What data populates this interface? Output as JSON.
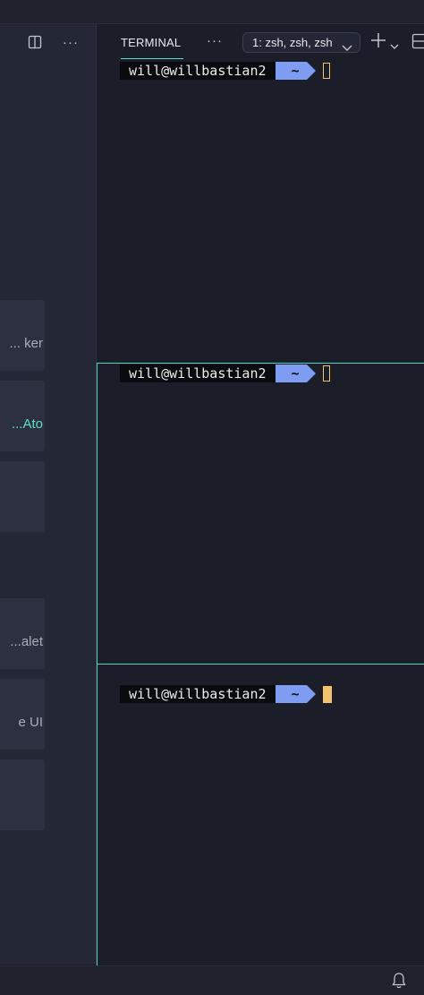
{
  "terminal_panel": {
    "tab_label": "TERMINAL",
    "more_label": "···",
    "terminal_select_value": "1: zsh, zsh, zsh",
    "icons": [
      "more-icon",
      "chevron-down-icon",
      "plus-icon",
      "split-terminal-icon"
    ]
  },
  "editor_pane": {
    "icons": [
      "split-editor-icon",
      "more-icon"
    ],
    "more_label": "···",
    "cards": [
      {
        "text": "ker ..."
      },
      {
        "text": "Ato..."
      },
      {
        "text": ""
      },
      {
        "text": "alet..."
      },
      {
        "text": "e UI"
      },
      {
        "text": ""
      }
    ]
  },
  "panes": [
    {
      "user": "will@willbastian2",
      "dir": "~",
      "cursor": "outline"
    },
    {
      "user": "will@willbastian2",
      "dir": "~",
      "cursor": "outline"
    },
    {
      "user": "will@willbastian2",
      "dir": "~",
      "cursor": "solid"
    }
  ],
  "colors": {
    "background": "#1b1e29",
    "accent": "#4ad6bc",
    "prompt_dir": "#7e9cf2",
    "cursor": "#f2c46d"
  },
  "statusbar": {
    "icons": [
      "bell-icon"
    ]
  }
}
